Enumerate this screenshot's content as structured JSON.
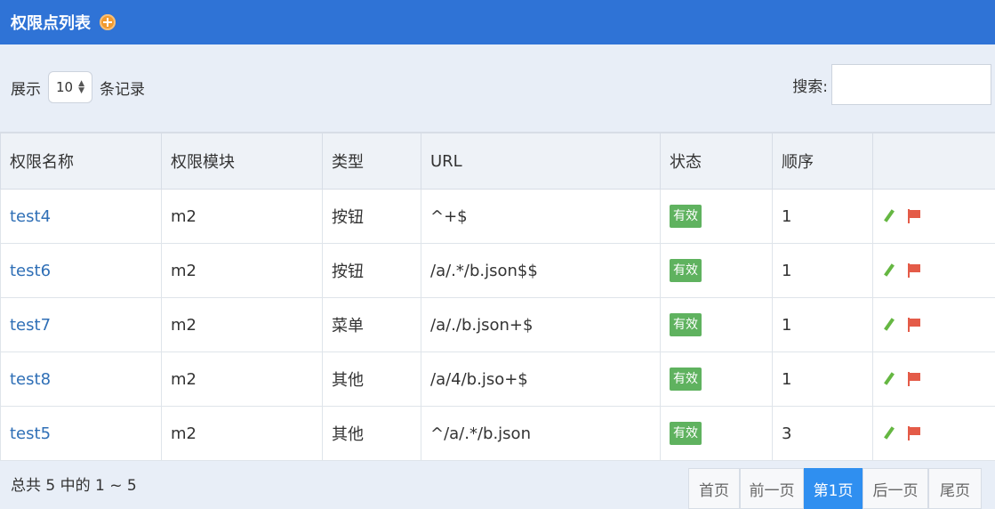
{
  "header": {
    "title": "权限点列表",
    "add_icon": "plus-circle-icon"
  },
  "controls": {
    "show_label": "展示",
    "page_size": "10",
    "records_label": "条记录",
    "search_label": "搜索:",
    "search_value": ""
  },
  "table": {
    "columns": [
      "权限名称",
      "权限模块",
      "类型",
      "URL",
      "状态",
      "顺序",
      ""
    ],
    "rows": [
      {
        "name": "test4",
        "module": "m2",
        "type": "按钮",
        "url": "^+$",
        "status": "有效",
        "order": "1"
      },
      {
        "name": "test6",
        "module": "m2",
        "type": "按钮",
        "url": "/a/.*/b.json$$",
        "status": "有效",
        "order": "1"
      },
      {
        "name": "test7",
        "module": "m2",
        "type": "菜单",
        "url": "/a/./b.json+$",
        "status": "有效",
        "order": "1"
      },
      {
        "name": "test8",
        "module": "m2",
        "type": "其他",
        "url": "/a/4/b.jso+$",
        "status": "有效",
        "order": "1"
      },
      {
        "name": "test5",
        "module": "m2",
        "type": "其他",
        "url": "^/a/.*/b.json",
        "status": "有效",
        "order": "3"
      }
    ]
  },
  "footer": {
    "summary": "总共 5 中的 1 ~ 5",
    "pagination": [
      "首页",
      "前一页",
      "第1页",
      "后一页",
      "尾页"
    ],
    "active_page": "第1页"
  },
  "colors": {
    "header": "#2f73d6",
    "badge": "#5fb25f",
    "pagination_active": "#2f8ff0",
    "link": "#2f6fb6"
  }
}
